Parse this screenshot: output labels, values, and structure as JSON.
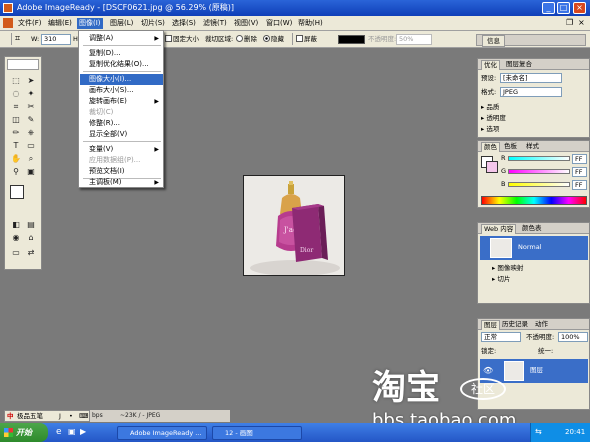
{
  "window": {
    "title": "Adobe ImageReady - [DSCF0621.jpg @ 56.29% (原稿)]",
    "controls": [
      "_",
      "□",
      "×"
    ]
  },
  "menubar": {
    "items": [
      "文件(F)",
      "编辑(E)",
      "图像(I)",
      "图层(L)",
      "切片(S)",
      "选择(S)",
      "滤镜(T)",
      "视图(V)",
      "窗口(W)",
      "帮助(H)"
    ],
    "active_index": 2,
    "app_icon": "imageready-logo-icon"
  },
  "options_bar": {
    "w_label": "W:",
    "w_value": "310",
    "h_label": "H",
    "fixed_size": "固定大小",
    "crop_area_label": "裁切区域:",
    "delete": "删除",
    "hide": "隐藏",
    "shield": "屏蔽",
    "opacity_label": "不透明度:",
    "opacity_value": "50%",
    "info_tab": "信息",
    "shield_color": "#000000"
  },
  "image_menu": {
    "items": [
      {
        "label": "调整(A)",
        "submenu": true
      },
      {
        "label": "复制(D)..."
      },
      {
        "label": "复制优化结果(O)..."
      },
      {
        "label": "图像大小(I)...",
        "highlighted": true
      },
      {
        "label": "画布大小(S)..."
      },
      {
        "label": "旋转画布(E)",
        "submenu": true
      },
      {
        "label": "裁切(C)",
        "disabled": true
      },
      {
        "label": "修整(R)..."
      },
      {
        "label": "显示全部(V)"
      },
      {
        "label": "变量(V)",
        "submenu": true
      },
      {
        "label": "应用数据组(P)...",
        "disabled": true
      },
      {
        "label": "预览文档(I)"
      },
      {
        "label": "主调板(M)",
        "submenu": true
      }
    ]
  },
  "optimize_panel": {
    "tabs": [
      "优化",
      "图层复合"
    ],
    "preset_label": "预设:",
    "preset_value": "[未命名]",
    "format_label": "格式:",
    "format_value": "JPEG",
    "sections": [
      "品质",
      "透明度",
      "选项"
    ]
  },
  "color_panel": {
    "tabs": [
      "颜色",
      "色板",
      "样式"
    ],
    "channels": [
      {
        "name": "R",
        "value": "FF"
      },
      {
        "name": "G",
        "value": "FF"
      },
      {
        "name": "B",
        "value": "FF"
      }
    ]
  },
  "web_panel": {
    "tabs": [
      "Web 内容",
      "颜色表"
    ],
    "items": [
      "Normal",
      "图像映射",
      "切片"
    ]
  },
  "layers_panel": {
    "tabs": [
      "图层",
      "历史记录",
      "动作"
    ],
    "blend_mode": "正常",
    "opacity_label": "不透明度:",
    "opacity_value": "100%",
    "lock_label": "锁定:",
    "unify_label": "统一:",
    "layer_name": "图层"
  },
  "product_image": {
    "perfume_label": "J'adore",
    "box_label": "Dior"
  },
  "status_bar": {
    "format_info": "bps",
    "size_info": "~23K / - JPEG"
  },
  "ime": {
    "label": "极品五笔",
    "icons": [
      "中",
      "J",
      "•",
      "⌨"
    ]
  },
  "taskbar": {
    "start": "开始",
    "tasks": [
      "Adobe ImageReady ...",
      "12 - 画图"
    ],
    "clock": "20:41"
  },
  "watermark": {
    "title": "淘宝",
    "badge": "社区",
    "url": "bbs.taobao.com"
  },
  "colors": {
    "title_bar": "#1a4fc8",
    "menu_highlight": "#316ac5",
    "workspace": "#7a7a7a",
    "layer_selected": "#3a6ec8",
    "foreground_swatch": "#ffffff",
    "background_swatch": "#f4c6ea"
  }
}
